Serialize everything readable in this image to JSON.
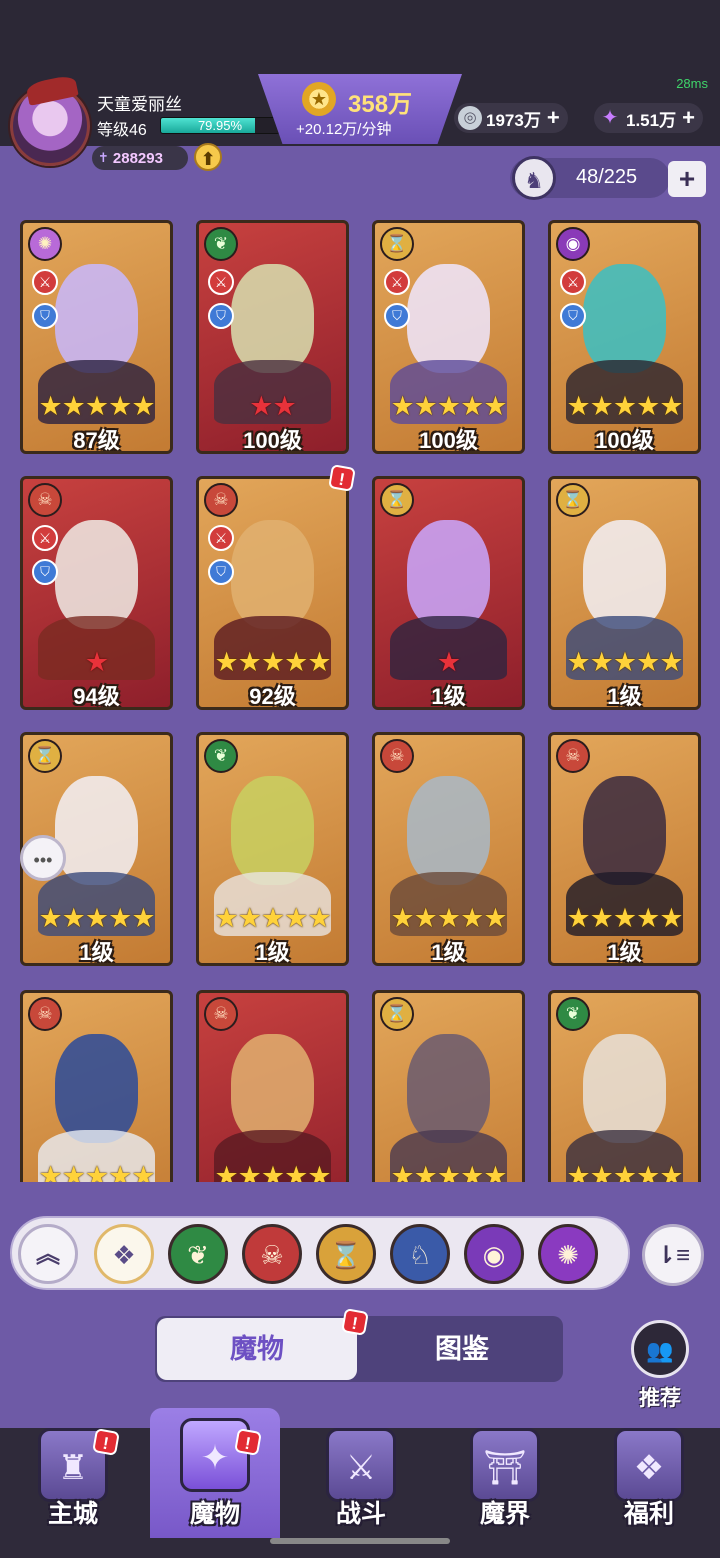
{
  "status": {
    "ping": "28ms"
  },
  "player": {
    "name": "天童爱丽丝",
    "level_label": "等级46",
    "exp_percent_text": "79.95%",
    "exp_percent": 79.95,
    "power": "288293"
  },
  "resources": {
    "gold": "358万",
    "gold_rate": "+20.12万/分钟",
    "silver": "1973万",
    "gems": "1.51万"
  },
  "collection": {
    "count": "48/225"
  },
  "cards": [
    {
      "element": "purple-swirl",
      "bg": "gold",
      "stars": 5,
      "star_color": "gold",
      "level": "87级",
      "sword": true,
      "shield": true,
      "fig": "#c8b8ff",
      "body": "#2a2040"
    },
    {
      "element": "green-leaf",
      "bg": "red",
      "stars": 2,
      "star_color": "red",
      "level": "100级",
      "sword": true,
      "shield": true,
      "fig": "#d8e0b0",
      "body": "#4a3040"
    },
    {
      "element": "gold-hourglass",
      "bg": "gold",
      "stars": 5,
      "star_color": "gold",
      "level": "100级",
      "sword": true,
      "shield": true,
      "fig": "#efe6ff",
      "body": "#5b4a9a"
    },
    {
      "element": "purple-eye",
      "bg": "gold",
      "stars": 5,
      "star_color": "gold",
      "level": "100级",
      "sword": true,
      "shield": true,
      "fig": "#39c0c4",
      "body": "#2a2430"
    },
    {
      "element": "red-skull",
      "bg": "red",
      "stars": 1,
      "star_color": "red",
      "level": "94级",
      "sword": true,
      "shield": true,
      "fig": "#f0ece6",
      "body": "#7a2a22"
    },
    {
      "element": "red-skull",
      "bg": "gold",
      "stars": 5,
      "star_color": "gold",
      "level": "92级",
      "sword": true,
      "shield": true,
      "fig": "#e0b070",
      "body": "#5a1a22",
      "alert": true
    },
    {
      "element": "gold-hourglass",
      "bg": "red",
      "stars": 1,
      "star_color": "red",
      "level": "1级",
      "sword": false,
      "shield": false,
      "fig": "#c9a8ff",
      "body": "#2e2440"
    },
    {
      "element": "gold-hourglass",
      "bg": "gold",
      "stars": 5,
      "star_color": "gold",
      "level": "1级",
      "sword": false,
      "shield": false,
      "fig": "#f2f0f6",
      "body": "#3a4a7a"
    },
    {
      "element": "gold-hourglass",
      "bg": "gold",
      "stars": 5,
      "star_color": "gold",
      "level": "1级",
      "sword": false,
      "shield": false,
      "fig": "#f2f0f6",
      "body": "#3a4a7a"
    },
    {
      "element": "green-leaf",
      "bg": "gold",
      "stars": 5,
      "star_color": "gold",
      "level": "1级",
      "sword": false,
      "shield": false,
      "fig": "#c8d060",
      "body": "#e8e4e0"
    },
    {
      "element": "red-skull",
      "bg": "gold",
      "stars": 5,
      "star_color": "gold",
      "level": "1级",
      "sword": false,
      "shield": false,
      "fig": "#a8b8c8",
      "body": "#6a4a3a"
    },
    {
      "element": "red-skull",
      "bg": "gold",
      "stars": 5,
      "star_color": "gold",
      "level": "1级",
      "sword": false,
      "shield": false,
      "fig": "#3a2a40",
      "body": "#1e1a28"
    },
    {
      "element": "red-skull",
      "bg": "gold",
      "stars": 5,
      "star_color": "gold",
      "level": "",
      "sword": false,
      "shield": false,
      "fig": "#2a4a9a",
      "body": "#e8ecf4"
    },
    {
      "element": "red-skull",
      "bg": "red",
      "stars": 5,
      "star_color": "gold",
      "level": "",
      "sword": false,
      "shield": false,
      "fig": "#e0b070",
      "body": "#5a1a22"
    },
    {
      "element": "gold-hourglass",
      "bg": "gold",
      "stars": 5,
      "star_color": "gold",
      "level": "",
      "sword": false,
      "shield": false,
      "fig": "#6a5a70",
      "body": "#4a3a50"
    },
    {
      "element": "green-leaf",
      "bg": "gold",
      "stars": 5,
      "star_color": "gold",
      "level": "",
      "sword": false,
      "shield": false,
      "fig": "#e8e0d8",
      "body": "#3a3040"
    }
  ],
  "filters": [
    {
      "name": "collapse",
      "icon": "chevron-up-icon"
    },
    {
      "name": "all",
      "icon": "diamond-grid-icon"
    },
    {
      "name": "green-leaf",
      "icon": "leaf-icon",
      "color": "#2f8a44"
    },
    {
      "name": "red-skull",
      "icon": "skull-icon",
      "color": "#c03a3a"
    },
    {
      "name": "gold-hourglass",
      "icon": "hourglass-icon",
      "color": "#d9a23a"
    },
    {
      "name": "blue-dragon",
      "icon": "dragon-icon",
      "color": "#3a5aa8"
    },
    {
      "name": "purple-eye",
      "icon": "eye-icon",
      "color": "#7a3ab8"
    },
    {
      "name": "purple-swirl",
      "icon": "swirl-icon",
      "color": "#8a3ac0"
    }
  ],
  "tabs": {
    "monsters": "魔物",
    "codex": "图鉴"
  },
  "recommend": {
    "label": "推荐"
  },
  "nav": [
    {
      "label": "主城",
      "icon": "castle-icon",
      "alert": true
    },
    {
      "label": "魔物",
      "icon": "flame-icon",
      "alert": true,
      "active": true
    },
    {
      "label": "战斗",
      "icon": "sword-icon",
      "alert": false
    },
    {
      "label": "魔界",
      "icon": "portal-icon",
      "alert": false
    },
    {
      "label": "福利",
      "icon": "chest-icon",
      "alert": false
    }
  ],
  "colors": {
    "accent": "#7858c8",
    "star": "#ffd23a",
    "alert": "#e22b33"
  }
}
